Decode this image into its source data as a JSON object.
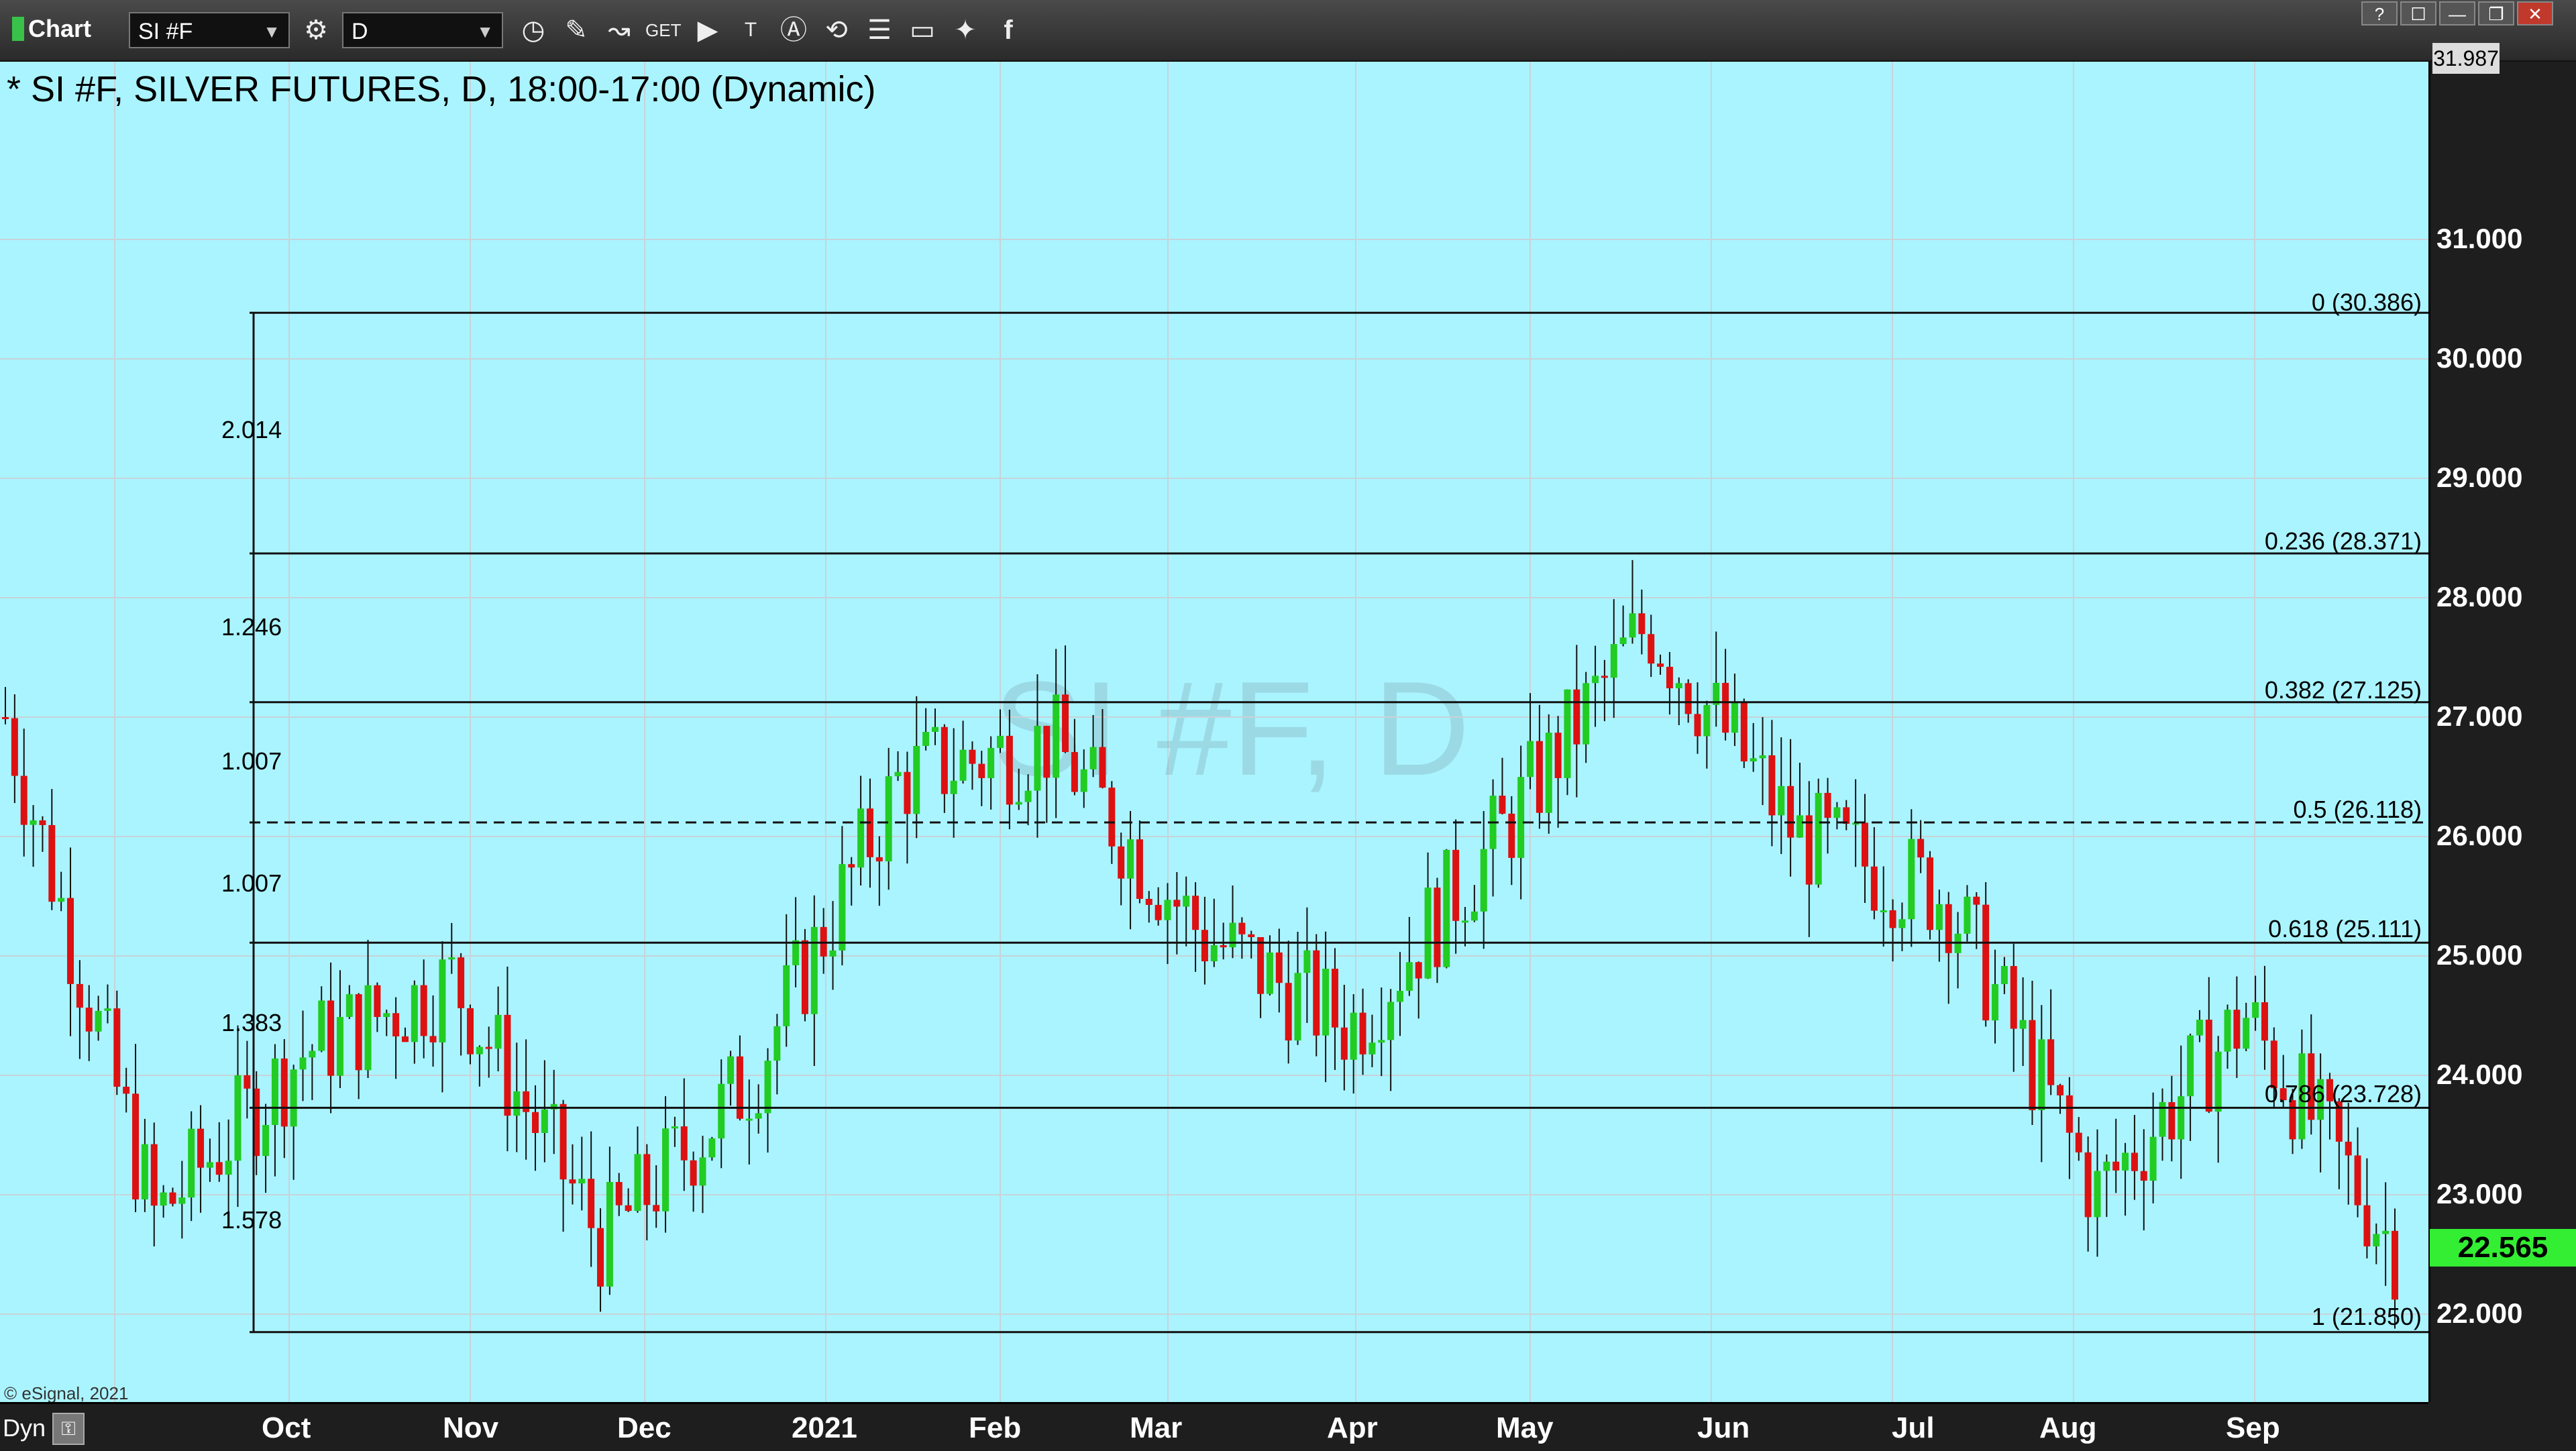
{
  "toolbar": {
    "title": "Chart",
    "symbol": "SI #F",
    "interval": "D",
    "window_buttons": [
      "?",
      "☐",
      "—",
      "❐",
      "✕"
    ]
  },
  "chart_header": {
    "title": "* SI #F, SILVER FUTURES, D, 18:00-17:00 (Dynamic)",
    "watermark": "SI #F, D",
    "copyright": "© eSignal, 2021"
  },
  "price_axis": {
    "labels": [
      "31.000",
      "30.000",
      "29.000",
      "28.000",
      "27.000",
      "26.000",
      "25.000",
      "24.000",
      "23.000",
      "22.000"
    ],
    "top_value": "31.987",
    "last_price": "22.565",
    "last_price_color": "#33ee33"
  },
  "time_axis": {
    "labels": [
      "Oct",
      "Nov",
      "Dec",
      "2021",
      "Feb",
      "Mar",
      "Apr",
      "May",
      "Jun",
      "Jul",
      "Aug",
      "Sep"
    ]
  },
  "footer": {
    "mode": "Dyn"
  },
  "fibonacci": {
    "levels": [
      {
        "label": "0 (30.386)",
        "price": 30.386
      },
      {
        "label": "0.236 (28.371)",
        "price": 28.371
      },
      {
        "label": "0.382 (27.125)",
        "price": 27.125
      },
      {
        "label": "0.5 (26.118)",
        "price": 26.118,
        "dashed": true
      },
      {
        "label": "0.618 (25.111)",
        "price": 25.111
      },
      {
        "label": "0.786 (23.728)",
        "price": 23.728
      },
      {
        "label": "1 (21.850)",
        "price": 21.85
      }
    ],
    "ratio_labels": [
      "2.014",
      "1.246",
      "1.007",
      "1.007",
      "1.383",
      "1.578"
    ]
  },
  "chart_data": {
    "type": "candlestick",
    "title": "* SI #F, SILVER FUTURES, D, 18:00-17:00 (Dynamic)",
    "ylim": [
      21.0,
      32.0
    ],
    "up_color": "#22cc22",
    "down_color": "#dd1111",
    "anchors": [
      {
        "month": "Sep 2020",
        "close": 27.0
      },
      {
        "month": "Late Sep 2020",
        "close": 22.8
      },
      {
        "month": "Oct",
        "close": 24.2
      },
      {
        "month": "Nov",
        "close": 24.8
      },
      {
        "month": "Late Nov",
        "close": 22.6
      },
      {
        "month": "Dec",
        "close": 24.0
      },
      {
        "month": "2021",
        "close": 26.5
      },
      {
        "month": "Feb",
        "close": 26.8
      },
      {
        "month": "Mar",
        "close": 25.2
      },
      {
        "month": "Apr",
        "close": 24.4
      },
      {
        "month": "May",
        "close": 26.0
      },
      {
        "month": "Jun",
        "close": 27.8
      },
      {
        "month": "Jul",
        "close": 26.0
      },
      {
        "month": "Aug",
        "close": 25.5
      },
      {
        "month": "Late Aug",
        "close": 23.0
      },
      {
        "month": "Sep",
        "close": 24.5
      },
      {
        "month": "Late Sep 2021",
        "close": 22.565
      }
    ]
  }
}
